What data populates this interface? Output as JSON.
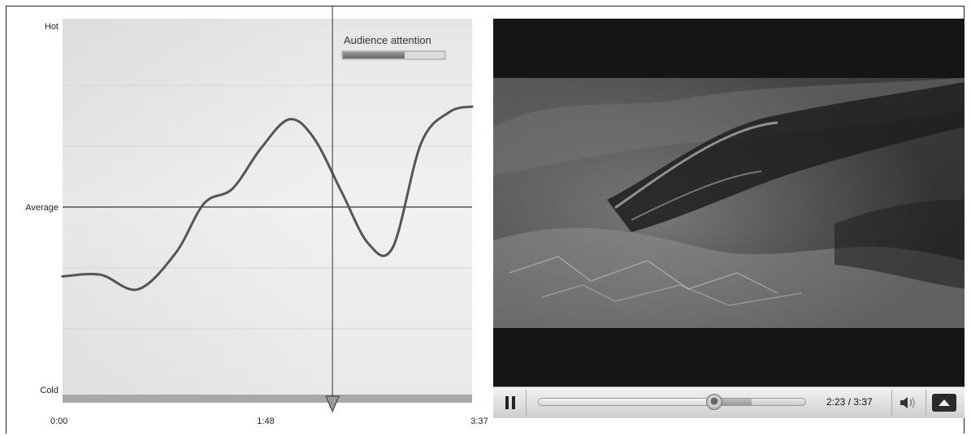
{
  "chart_data": {
    "type": "line",
    "title": "",
    "legend": {
      "label": "Audience attention",
      "placement": "top-right"
    },
    "y_tick_labels": [
      "Hot",
      "Average",
      "Cold"
    ],
    "x_tick_labels": [
      "0:00",
      "1:48",
      "3:37"
    ],
    "x_range_seconds": [
      0,
      217
    ],
    "y_range": [
      -1,
      1
    ],
    "reference_line": {
      "label": "Average",
      "y": 0
    },
    "playhead_seconds": 143,
    "series": [
      {
        "x": [
          0,
          20,
          40,
          60,
          75,
          90,
          105,
          120,
          133,
          148,
          162,
          175,
          190,
          205,
          217
        ],
        "y": [
          -0.38,
          -0.37,
          -0.45,
          -0.25,
          0.02,
          0.1,
          0.32,
          0.48,
          0.38,
          0.08,
          -0.2,
          -0.22,
          0.35,
          0.52,
          0.55
        ]
      }
    ],
    "grid": true
  },
  "colors": {
    "line": "#555555",
    "grid": "#d6d6d6",
    "player_bg": "#151515",
    "bottom_band": "#a8a8a8"
  },
  "player": {
    "current_time": "2:23",
    "duration": "3:37",
    "time_display": "2:23 / 3:37",
    "progress": 0.659,
    "buffered": 0.8,
    "icons": {
      "pause": "pause-icon",
      "volume": "volume-icon",
      "expand": "expand-icon"
    }
  }
}
